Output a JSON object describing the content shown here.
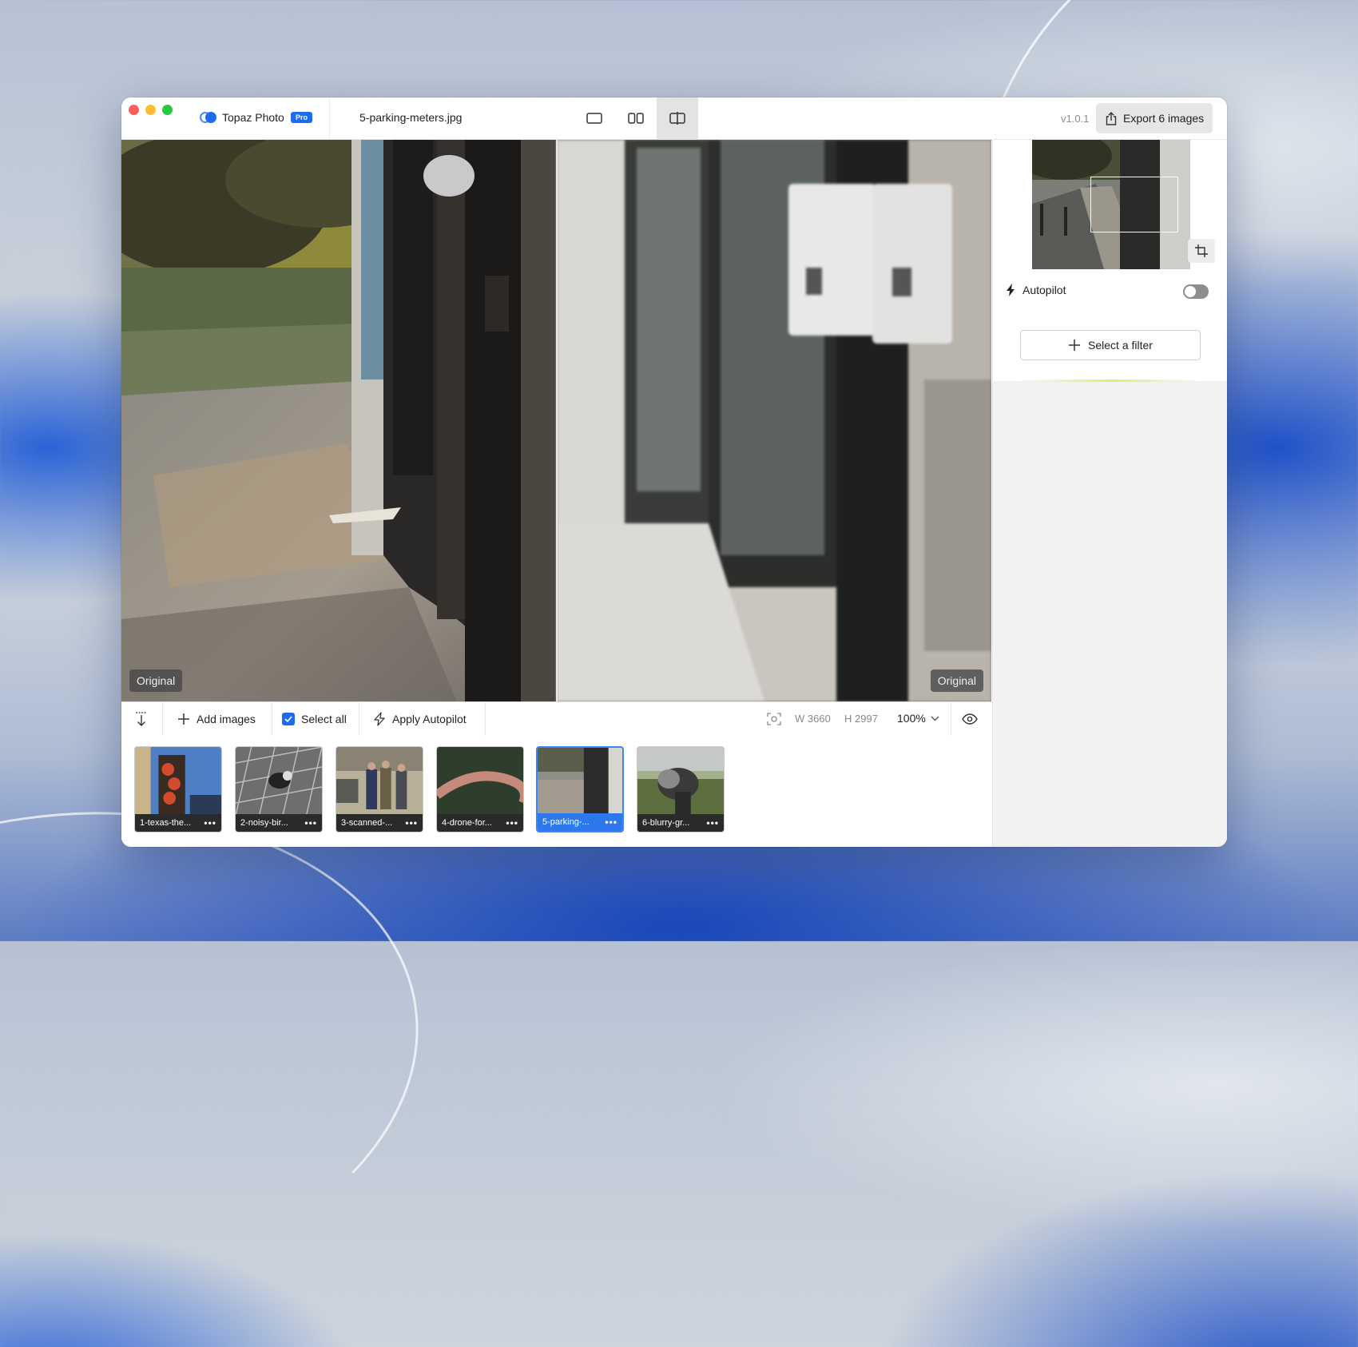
{
  "app": {
    "name": "Topaz Photo",
    "badge": "Pro",
    "filename": "5-parking-meters.jpg",
    "version": "v1.0.1",
    "export_label": "Export 6 images"
  },
  "view_modes": [
    {
      "name": "single-view",
      "icon": "single-view-icon",
      "active": false
    },
    {
      "name": "side-by-side",
      "icon": "side-by-side-icon",
      "active": false
    },
    {
      "name": "split-view",
      "icon": "split-view-icon",
      "active": true
    }
  ],
  "canvas": {
    "left_label": "Original",
    "right_label": "Original"
  },
  "toolbar": {
    "add_images": "Add images",
    "select_all": "Select all",
    "apply_autopilot": "Apply Autopilot",
    "width": "W 3660",
    "height": "H 2997",
    "zoom": "100%"
  },
  "thumbnails": [
    {
      "label": "1-texas-the...",
      "selected": false
    },
    {
      "label": "2-noisy-bir...",
      "selected": false
    },
    {
      "label": "3-scanned-...",
      "selected": false
    },
    {
      "label": "4-drone-for...",
      "selected": false
    },
    {
      "label": "5-parking-...",
      "selected": true
    },
    {
      "label": "6-blurry-gr...",
      "selected": false
    }
  ],
  "sidepanel": {
    "autopilot_label": "Autopilot",
    "autopilot_enabled": false,
    "select_filter": "Select a filter"
  },
  "colors": {
    "accent": "#1d6cf0",
    "selected_border": "#3a86f7"
  }
}
